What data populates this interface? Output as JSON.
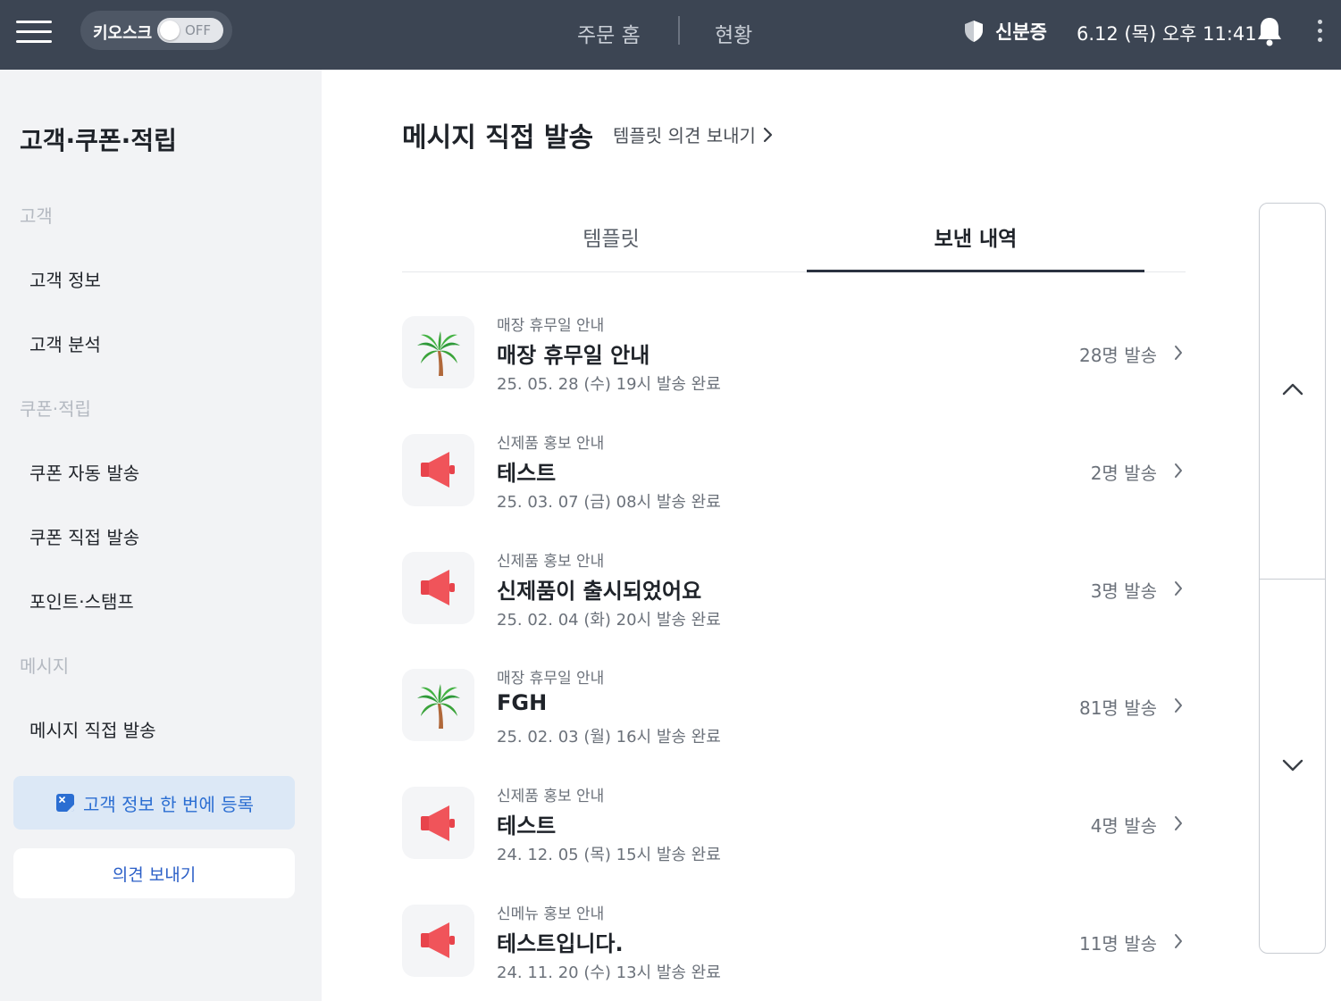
{
  "topbar": {
    "kiosk_label": "키오스크",
    "kiosk_state": "OFF",
    "nav_home": "주문 홈",
    "nav_status": "현황",
    "id_label": "신분증",
    "datetime": "6.12 (목) 오후 11:41"
  },
  "sidebar": {
    "title": "고객·쿠폰·적립",
    "section_customer": "고객",
    "item_customer_info": "고객 정보",
    "item_customer_analysis": "고객 분석",
    "section_coupon": "쿠폰·적립",
    "item_coupon_auto": "쿠폰 자동 발송",
    "item_coupon_direct": "쿠폰 직접 발송",
    "item_point_stamp": "포인트·스탬프",
    "section_message": "메시지",
    "item_message_direct": "메시지 직접 발송",
    "bulk_register": "고객 정보 한 번에 등록",
    "feedback": "의견 보내기"
  },
  "main": {
    "title": "메시지 직접 발송",
    "template_link": "템플릿 의견 보내기",
    "tabs": [
      {
        "label": "템플릿",
        "active": false
      },
      {
        "label": "보낸 내역",
        "active": true
      }
    ],
    "rows": [
      {
        "icon": "palm-tree-icon",
        "category": "매장 휴무일 안내",
        "title": "매장 휴무일 안내",
        "date": "25. 05. 28 (수) 19시 발송 완료",
        "count": "28명 발송"
      },
      {
        "icon": "megaphone-icon",
        "category": "신제품 홍보 안내",
        "title": "테스트",
        "date": "25. 03. 07 (금) 08시 발송 완료",
        "count": "2명 발송"
      },
      {
        "icon": "megaphone-icon",
        "category": "신제품 홍보 안내",
        "title": "신제품이 출시되었어요",
        "date": "25. 02. 04 (화) 20시 발송 완료",
        "count": "3명 발송"
      },
      {
        "icon": "palm-tree-icon",
        "category": "매장 휴무일 안내",
        "title": "FGH",
        "date": "25. 02. 03 (월) 16시 발송 완료",
        "count": "81명 발송"
      },
      {
        "icon": "megaphone-icon",
        "category": "신제품 홍보 안내",
        "title": "테스트",
        "date": "24. 12. 05 (목) 15시 발송 완료",
        "count": "4명 발송"
      },
      {
        "icon": "megaphone-icon",
        "category": "신메뉴 홍보 안내",
        "title": "테스트입니다.",
        "date": "24. 11. 20 (수) 13시 발송 완료",
        "count": "11명 발송"
      }
    ]
  },
  "colors": {
    "topbar_bg": "#3c4553",
    "sidebar_bg": "#f2f3f5",
    "accent_blue": "#2b6ed2",
    "megaphone_red": "#f0545a",
    "palm_green": "#3aa33a"
  }
}
